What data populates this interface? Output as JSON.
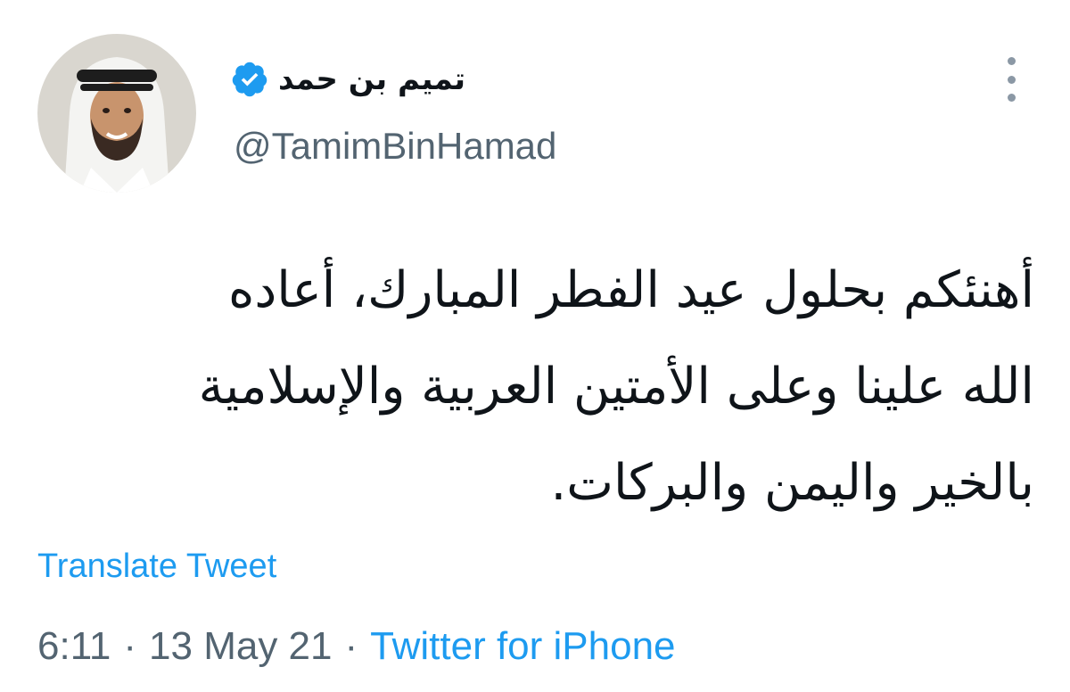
{
  "tweet": {
    "display_name": "تميم بن حمد",
    "handle": "@TamimBinHamad",
    "body_lines": [
      "أهنئكم بحلول عيد الفطر المبارك، أعاده",
      "الله علينا وعلى الأمتين العربية والإسلامية",
      "بالخير واليمن والبركات."
    ],
    "translate_label": "Translate Tweet",
    "time": "6:11",
    "date": "13 May 21",
    "separator": "·",
    "source": "Twitter for iPhone"
  },
  "icons": {
    "verified": "verified-badge-icon",
    "more": "more-vertical-icon"
  },
  "colors": {
    "link": "#1d9bf0",
    "secondary_text": "#536471",
    "primary_text": "#0f1419",
    "verified": "#1d9bf0"
  }
}
